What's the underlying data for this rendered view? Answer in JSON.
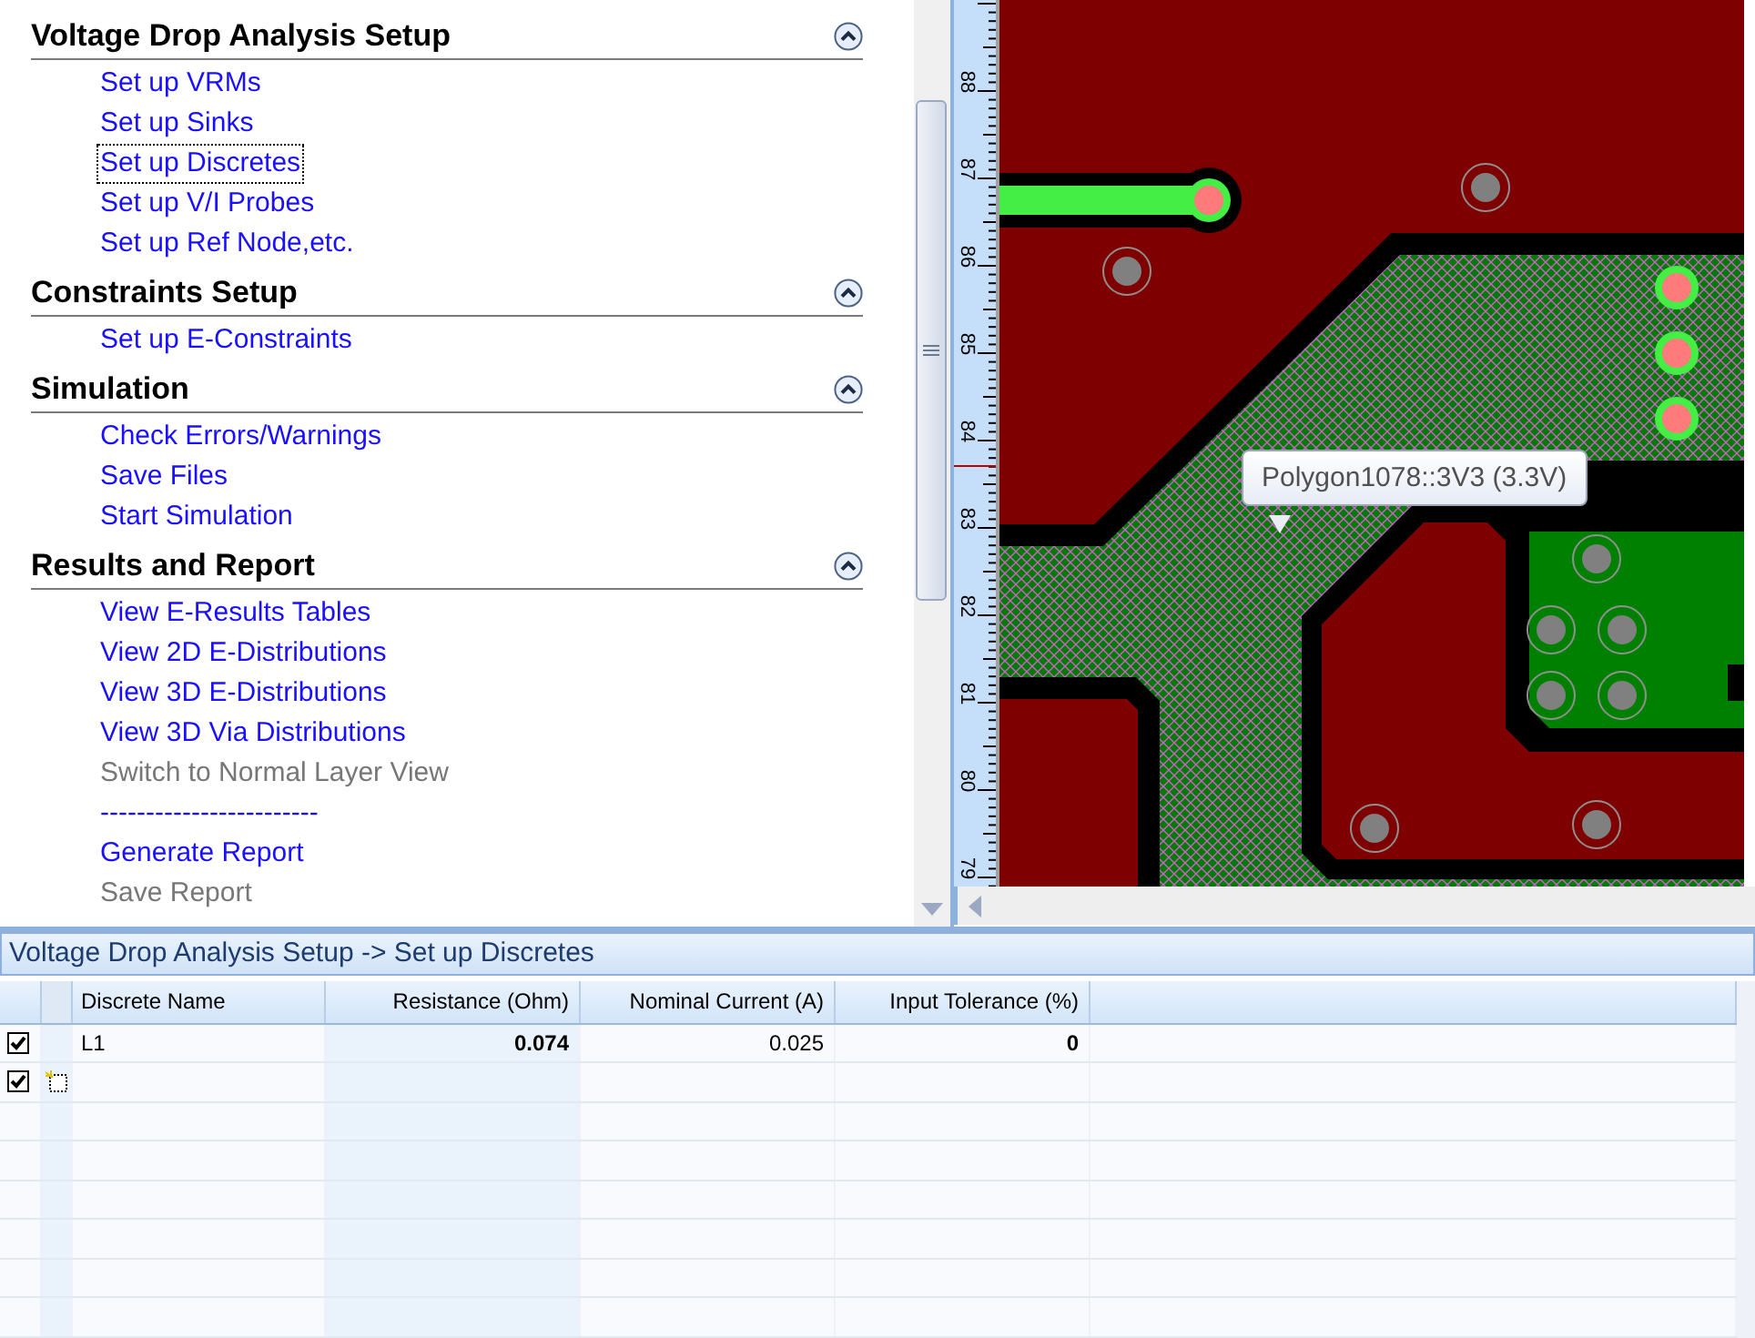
{
  "task_panel": {
    "sections": [
      {
        "title": "Voltage Drop Analysis Setup",
        "expanded": true,
        "items": [
          {
            "label": "Set up VRMs",
            "enabled": true,
            "selected": false
          },
          {
            "label": "Set up Sinks",
            "enabled": true,
            "selected": false
          },
          {
            "label": "Set up Discretes",
            "enabled": true,
            "selected": true
          },
          {
            "label": "Set up V/I Probes",
            "enabled": true,
            "selected": false
          },
          {
            "label": "Set up Ref Node,etc.",
            "enabled": true,
            "selected": false
          }
        ]
      },
      {
        "title": "Constraints Setup",
        "expanded": true,
        "items": [
          {
            "label": "Set up E-Constraints",
            "enabled": true,
            "selected": false
          }
        ]
      },
      {
        "title": "Simulation",
        "expanded": true,
        "items": [
          {
            "label": "Check Errors/Warnings",
            "enabled": true,
            "selected": false
          },
          {
            "label": "Save Files",
            "enabled": true,
            "selected": false
          },
          {
            "label": "Start Simulation",
            "enabled": true,
            "selected": false
          }
        ]
      },
      {
        "title": "Results and Report",
        "expanded": true,
        "items": [
          {
            "label": "View E-Results Tables",
            "enabled": true,
            "selected": false
          },
          {
            "label": "View 2D E-Distributions",
            "enabled": true,
            "selected": false
          },
          {
            "label": "View 3D E-Distributions",
            "enabled": true,
            "selected": false
          },
          {
            "label": "View 3D Via Distributions",
            "enabled": true,
            "selected": false
          },
          {
            "label": "Switch to Normal Layer View",
            "enabled": false,
            "selected": false
          },
          {
            "label": "------------------------",
            "enabled": true,
            "selected": false
          },
          {
            "label": "Generate Report",
            "enabled": true,
            "selected": false
          },
          {
            "label": "Save Report",
            "enabled": false,
            "selected": false
          }
        ]
      }
    ]
  },
  "layout_view": {
    "ruler_labels": [
      "88",
      "87",
      "86",
      "85",
      "84",
      "83",
      "82",
      "81",
      "80",
      "79"
    ],
    "tooltip": "Polygon1078::3V3 (3.3V)"
  },
  "discretes_panel": {
    "title": "Voltage Drop Analysis Setup -> Set up Discretes",
    "columns": [
      "Discrete Name",
      "Resistance (Ohm)",
      "Nominal Current (A)",
      "Input Tolerance (%)"
    ],
    "rows": [
      {
        "checked": true,
        "new_row": false,
        "cells": [
          {
            "text": "L1",
            "bold": false
          },
          {
            "text": "0.074",
            "bold": true
          },
          {
            "text": "0.025",
            "bold": false
          },
          {
            "text": "0",
            "bold": true
          }
        ]
      },
      {
        "checked": true,
        "new_row": true,
        "cells": []
      }
    ]
  }
}
